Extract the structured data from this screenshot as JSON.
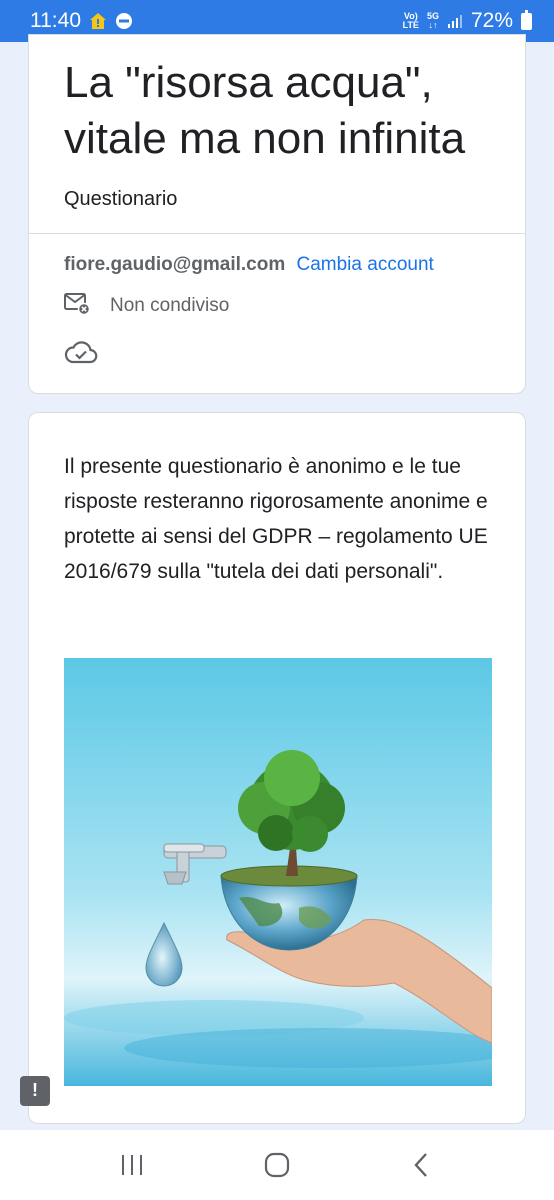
{
  "status_bar": {
    "time": "11:40",
    "network_top": "Vo)",
    "network_bottom": "LTE",
    "signal_gen": "5G",
    "battery": "72%"
  },
  "form": {
    "title": "La \"risorsa acqua\", vitale ma non infinita",
    "subtitle": "Questionario",
    "account_email": "fiore.gaudio@gmail.com",
    "switch_account": "Cambia account",
    "not_shared": "Non condiviso",
    "description": "Il presente questionario è anonimo e le tue risposte resteranno rigorosamente anonime e protette ai sensi del GDPR – regolamento UE 2016/679 sulla \"tutela dei dati personali\"."
  },
  "feedback_icon": "!",
  "icons": {
    "mail_off": "mail-off-icon",
    "cloud_check": "cloud-check-icon",
    "feedback": "feedback-icon",
    "recents": "recents-icon",
    "home": "home-icon",
    "back": "back-icon"
  },
  "colors": {
    "status_bar": "#2f7be5",
    "link": "#1a73e8",
    "page_bg": "#e9effb"
  }
}
